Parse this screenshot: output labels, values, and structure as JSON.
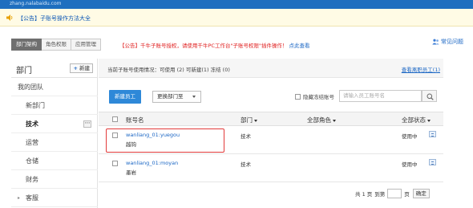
{
  "topbar": {
    "text": "zhang.nalabaidu.com"
  },
  "notice": {
    "text": "【公告】子账号操作方法大全"
  },
  "tabs": [
    "部门架构",
    "角色权限",
    "应用管理"
  ],
  "announcement": {
    "text": "【公告】千牛子账号授权，请使用千牛PC工作台\"子账号权限\"插件操作！",
    "link": "点此查看"
  },
  "faq": {
    "label": "常见问题"
  },
  "sidebar": {
    "title": "部门",
    "new_button": "新建",
    "team": "我的团队",
    "items": [
      "新部门",
      "技术",
      "运营",
      "仓储",
      "财务",
      "客服"
    ],
    "active_index": 1,
    "more_glyph": "···"
  },
  "main": {
    "status_text": "当前子账号使用情况：可使用 (2)   可新建(1)   冻结 (0)",
    "view_departed": "查看离职员工(1)",
    "new_employee": "新建员工",
    "change_dept": "更换部门至",
    "hide_frozen": "隐藏冻结账号",
    "search_placeholder": "请输入员工账号名"
  },
  "table": {
    "headers": {
      "account": "账号名",
      "dept": "部门",
      "role": "全部角色",
      "status": "全部状态"
    },
    "rows": [
      {
        "account": "wanliang_01:yuegou",
        "nickname": "越钩",
        "dept": "技术",
        "status": "使用中"
      },
      {
        "account": "wanliang_01:moyan",
        "nickname": "墨岩",
        "dept": "技术",
        "status": "使用中"
      }
    ]
  },
  "pager": {
    "total": "共 1 页",
    "goto": "到第",
    "page_unit": "页",
    "confirm": "确定"
  },
  "colors": {
    "primary": "#2e88d8",
    "link": "#1a66c4",
    "alert": "#e02020",
    "highlight": "#e23a3a"
  }
}
